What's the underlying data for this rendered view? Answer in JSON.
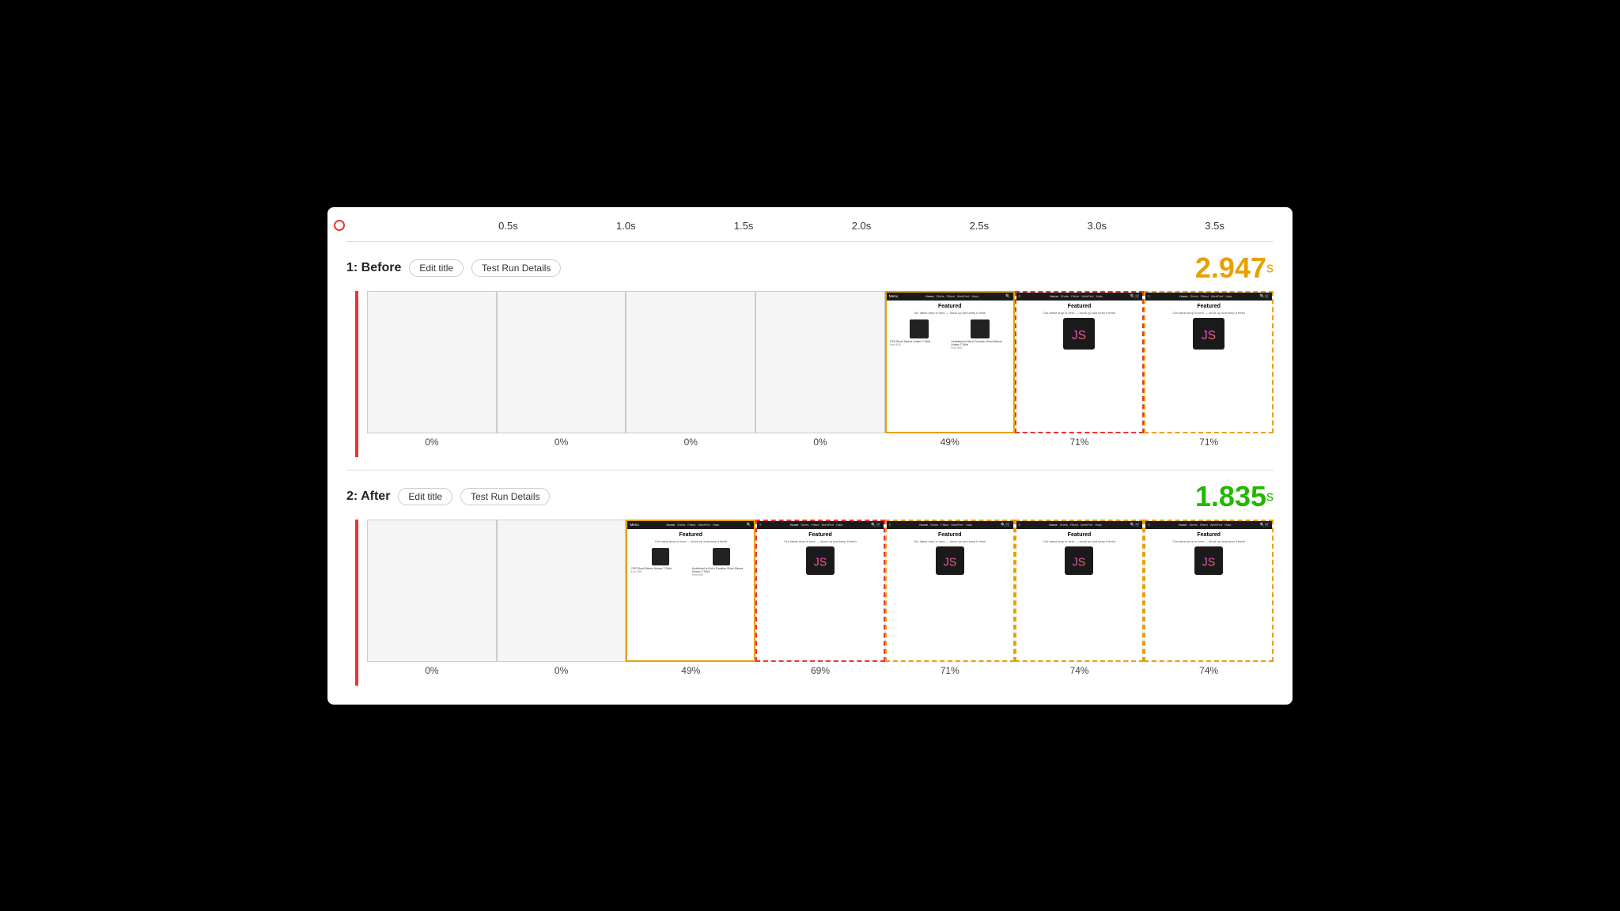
{
  "timeline": {
    "ticks": [
      "0.5s",
      "1.0s",
      "1.5s",
      "2.0s",
      "2.5s",
      "3.0s",
      "3.5s"
    ]
  },
  "before": {
    "label": "1: Before",
    "edit_title": "Edit title",
    "test_run": "Test Run Details",
    "score": "2.947",
    "score_unit": "s",
    "frames": [
      {
        "percent": "0%",
        "style": "empty"
      },
      {
        "percent": "0%",
        "style": "empty"
      },
      {
        "percent": "0%",
        "style": "empty"
      },
      {
        "percent": "0%",
        "style": "empty"
      },
      {
        "percent": "49%",
        "style": "yellow"
      },
      {
        "percent": "71%",
        "style": "red-dashed"
      },
      {
        "percent": "71%",
        "style": "yellow-dashed"
      }
    ]
  },
  "after": {
    "label": "2: After",
    "edit_title": "Edit title",
    "test_run": "Test Run Details",
    "score": "1.835",
    "score_unit": "s",
    "frames": [
      {
        "percent": "0%",
        "style": "empty"
      },
      {
        "percent": "0%",
        "style": "empty"
      },
      {
        "percent": "49%",
        "style": "yellow"
      },
      {
        "percent": "69%",
        "style": "red-dashed"
      },
      {
        "percent": "71%",
        "style": "yellow-dashed"
      },
      {
        "percent": "74%",
        "style": "yellow-dashed"
      },
      {
        "percent": "74%",
        "style": "yellow-dashed"
      }
    ]
  }
}
